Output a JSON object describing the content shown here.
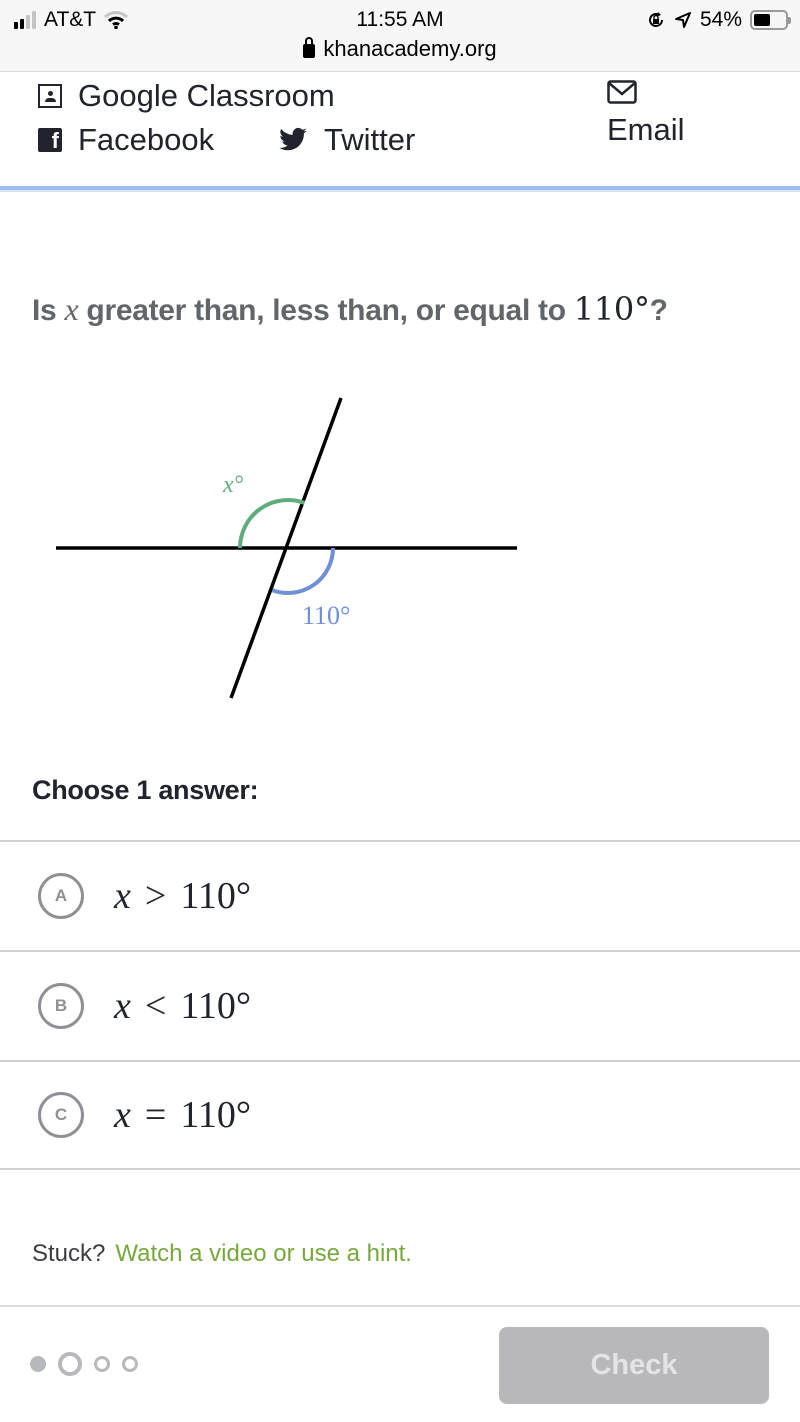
{
  "status_bar": {
    "carrier": "AT&T",
    "time": "11:55 AM",
    "battery_percent_label": "54%",
    "battery_level": 0.54,
    "signal_bars_on": 2,
    "signal_bars_total": 4,
    "icons": [
      "signal-icon",
      "wifi-icon",
      "orientation-lock-icon",
      "location-icon",
      "battery-icon"
    ]
  },
  "url_bar": {
    "domain": "khanacademy.org",
    "icon": "lock-icon"
  },
  "share": {
    "google_classroom": "Google Classroom",
    "facebook": "Facebook",
    "twitter": "Twitter",
    "email": "Email"
  },
  "question": {
    "prefix": "Is",
    "variable": "x",
    "middle": "greater than, less than, or equal to",
    "value": "110°",
    "suffix": "?"
  },
  "figure": {
    "angle_x_label": "x°",
    "angle_known_label": "110°",
    "angle_known_value": 110,
    "colors": {
      "angle_x": "#5fad7a",
      "angle_known": "#6f90d6",
      "lines": "#000000"
    }
  },
  "choose_label": "Choose 1 answer:",
  "choices": [
    {
      "letter": "A",
      "var": "x",
      "op": ">",
      "value": "110°"
    },
    {
      "letter": "B",
      "var": "x",
      "op": "<",
      "value": "110°"
    },
    {
      "letter": "C",
      "var": "x",
      "op": "=",
      "value": "110°"
    }
  ],
  "help": {
    "stuck": "Stuck?",
    "hint_link": "Watch a video or use a hint."
  },
  "progress": {
    "completed": 1,
    "current": 2,
    "total": 4
  },
  "check_button": "Check",
  "colors": {
    "accent_blue_rule": "#9bc1ec",
    "hint_green": "#77a83e",
    "disabled_button": "#b8b8ba"
  }
}
